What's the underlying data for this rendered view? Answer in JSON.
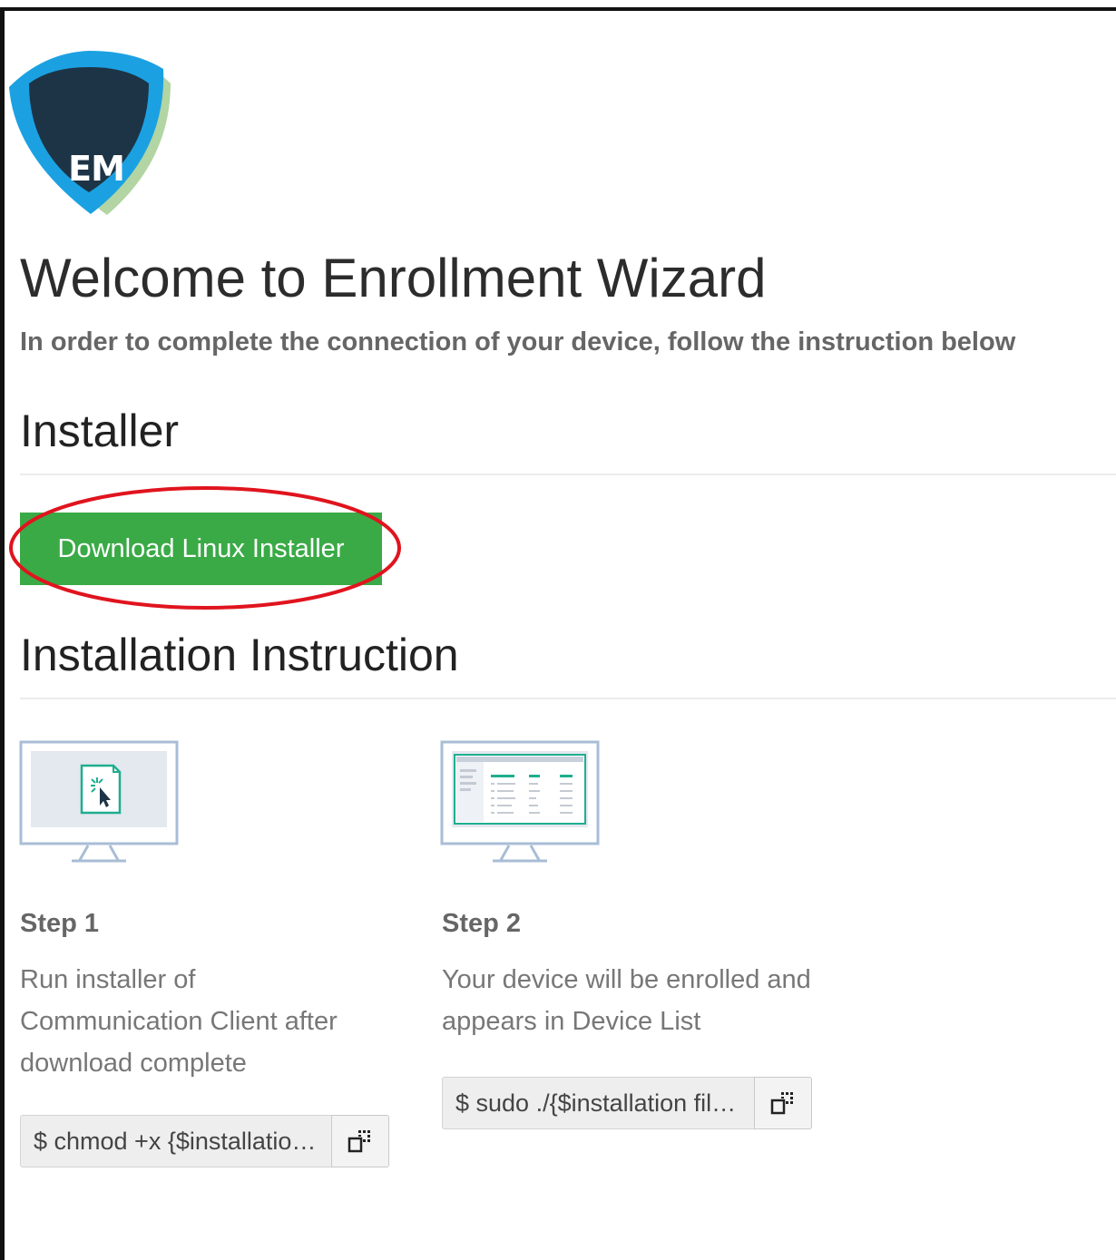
{
  "logo": {
    "text": "EM"
  },
  "header": {
    "title": "Welcome to Enrollment Wizard",
    "subtitle": "In order to complete the connection of your device, follow the instruction below"
  },
  "installer": {
    "heading": "Installer",
    "download_label": "Download Linux Installer"
  },
  "instruction": {
    "heading": "Installation Instruction",
    "steps": [
      {
        "title": "Step 1",
        "description": "Run installer of Communication Client after download complete",
        "command": "$ chmod +x {$installatio…",
        "illustration": "monitor-file-cursor-icon"
      },
      {
        "title": "Step 2",
        "description": "Your device will be enrolled and appears in Device List",
        "command": "$ sudo ./{$installation fil…",
        "illustration": "monitor-device-list-icon"
      }
    ]
  },
  "colors": {
    "brand_dark": "#1d3446",
    "brand_blue": "#1ba1e2",
    "accent_green": "#3aaa46",
    "annotation_red": "#e0141e",
    "teal": "#1fae8e"
  }
}
